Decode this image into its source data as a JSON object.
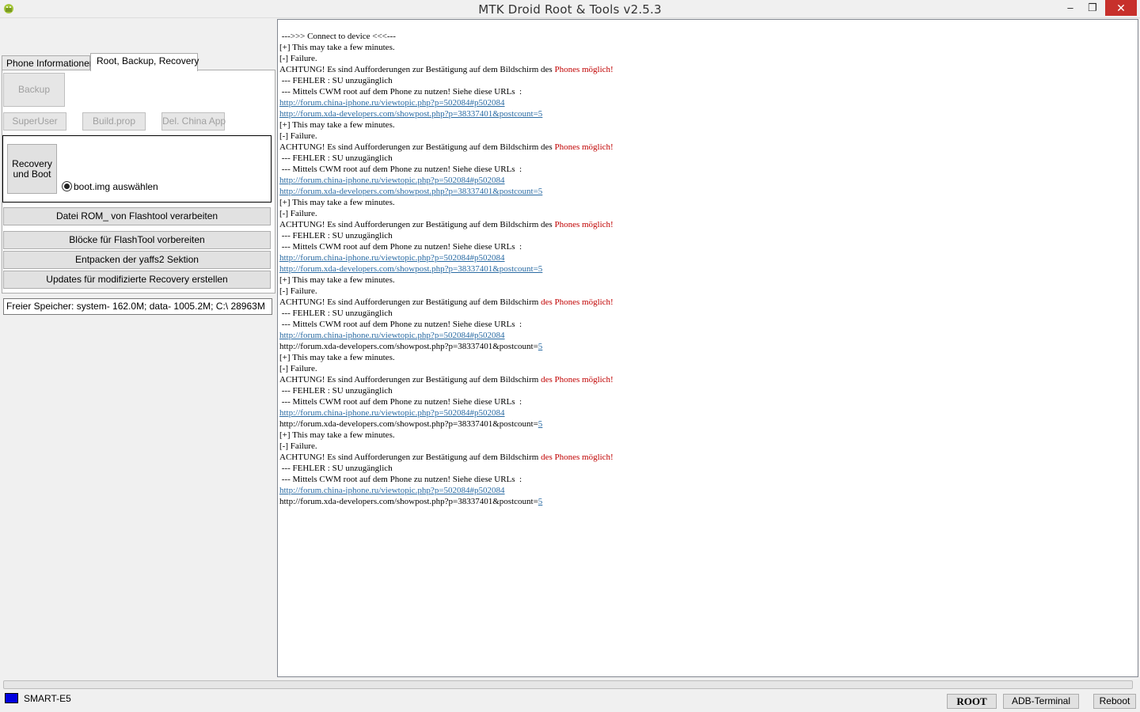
{
  "window": {
    "title": "MTK Droid Root & Tools v2.5.3",
    "min_glyph": "‒",
    "max_glyph": "❐",
    "close_glyph": "✕"
  },
  "tabs": {
    "phone": "Phone Informationen",
    "root": "Root, Backup, Recovery"
  },
  "panel": {
    "backup": "Backup",
    "superuser": "SuperUser",
    "buildprop": "Build.prop",
    "delchina": "Del. China App",
    "recovery": "Recovery und Boot",
    "radio_label": "boot.img auswählen",
    "datei": "Datei ROM_ von Flashtool verarbeiten",
    "bloecke": "Blöcke für FlashTool vorbereiten",
    "entpacken": "Entpacken der yaffs2 Sektion",
    "updates": "Updates für modifizierte Recovery erstellen"
  },
  "memory": "Freier Speicher: system- 162.0M; data- 1005.2M;  C:\\ 28963M",
  "log": [
    {
      "text": " --->>> Connect to device <<<---"
    },
    {
      "text": "[+] This may take a few minutes."
    },
    {
      "text": "[-] Failure."
    },
    {
      "text": "ACHTUNG! Es sind Aufforderungen zur Bestätigung auf dem Bildschirm des ",
      "red": "Phones möglich!"
    },
    {
      "text": " --- FEHLER : SU unzugänglich"
    },
    {
      "text": " --- Mittels CWM root auf dem Phone zu nutzen! Siehe diese URLs  :"
    },
    {
      "link": "http://forum.china-iphone.ru/viewtopic.php?p=502084#p502084"
    },
    {
      "link": "http://forum.xda-developers.com/showpost.php?p=38337401&postcount=5"
    },
    {
      "text": "[+] This may take a few minutes."
    },
    {
      "text": "[-] Failure."
    },
    {
      "text": "ACHTUNG! Es sind Aufforderungen zur Bestätigung auf dem Bildschirm des ",
      "red": "Phones möglich!"
    },
    {
      "text": " --- FEHLER : SU unzugänglich"
    },
    {
      "text": " --- Mittels CWM root auf dem Phone zu nutzen! Siehe diese URLs  :"
    },
    {
      "link": "http://forum.china-iphone.ru/viewtopic.php?p=502084#p502084"
    },
    {
      "link": "http://forum.xda-developers.com/showpost.php?p=38337401&postcount=5"
    },
    {
      "text": "[+] This may take a few minutes."
    },
    {
      "text": "[-] Failure."
    },
    {
      "text": "ACHTUNG! Es sind Aufforderungen zur Bestätigung auf dem Bildschirm des ",
      "red": "Phones möglich!"
    },
    {
      "text": " --- FEHLER : SU unzugänglich"
    },
    {
      "text": " --- Mittels CWM root auf dem Phone zu nutzen! Siehe diese URLs  :"
    },
    {
      "link": "http://forum.china-iphone.ru/viewtopic.php?p=502084#p502084"
    },
    {
      "link": "http://forum.xda-developers.com/showpost.php?p=38337401&postcount=5"
    },
    {
      "text": "[+] This may take a few minutes."
    },
    {
      "text": "[-] Failure."
    },
    {
      "text": "ACHTUNG! Es sind Aufforderungen zur Bestätigung auf dem Bildschirm ",
      "red": "des Phones möglich!"
    },
    {
      "text": " --- FEHLER : SU unzugänglich"
    },
    {
      "text": " --- Mittels CWM root auf dem Phone zu nutzen! Siehe diese URLs  :"
    },
    {
      "link": "http://forum.china-iphone.ru/viewtopic.php?p=502084#p502084"
    },
    {
      "text": "http://forum.xda-developers.com/showpost.php?p=38337401&postcount=",
      "link": "5"
    },
    {
      "text": "[+] This may take a few minutes."
    },
    {
      "text": "[-] Failure."
    },
    {
      "text": "ACHTUNG! Es sind Aufforderungen zur Bestätigung auf dem Bildschirm ",
      "red": "des Phones möglich!"
    },
    {
      "text": " --- FEHLER : SU unzugänglich"
    },
    {
      "text": " --- Mittels CWM root auf dem Phone zu nutzen! Siehe diese URLs  :"
    },
    {
      "link": "http://forum.china-iphone.ru/viewtopic.php?p=502084#p502084"
    },
    {
      "text": "http://forum.xda-developers.com/showpost.php?p=38337401&postcount=",
      "link": "5"
    },
    {
      "text": "[+] This may take a few minutes."
    },
    {
      "text": "[-] Failure."
    },
    {
      "text": "ACHTUNG! Es sind Aufforderungen zur Bestätigung auf dem Bildschirm ",
      "red": "des Phones möglich!"
    },
    {
      "text": " --- FEHLER : SU unzugänglich"
    },
    {
      "text": " --- Mittels CWM root auf dem Phone zu nutzen! Siehe diese URLs  :"
    },
    {
      "link": "http://forum.china-iphone.ru/viewtopic.php?p=502084#p502084"
    },
    {
      "text": "http://forum.xda-developers.com/showpost.php?p=38337401&postcount=",
      "link": "5"
    }
  ],
  "status": {
    "device": "SMART-E5",
    "device_color": "#0000e0",
    "root": "ROOT",
    "adb": "ADB-Terminal",
    "reboot": "Reboot"
  }
}
